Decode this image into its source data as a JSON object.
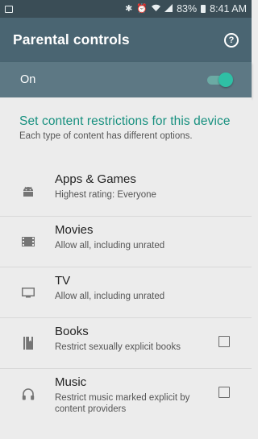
{
  "status_bar": {
    "time": "8:41 AM",
    "battery_percent": "83%",
    "icons": [
      "bluetooth-icon",
      "alarm-icon",
      "wifi-icon",
      "signal-icon",
      "battery-icon"
    ]
  },
  "app_bar": {
    "title": "Parental controls",
    "help_icon": "help-icon",
    "help_glyph": "?"
  },
  "master_switch": {
    "label": "On",
    "enabled": true
  },
  "section": {
    "title": "Set content restrictions for this device",
    "subtitle": "Each type of content has different options."
  },
  "content_types": [
    {
      "icon": "android-icon",
      "title": "Apps & Games",
      "subtitle": "Highest rating: Everyone"
    },
    {
      "icon": "film-icon",
      "title": "Movies",
      "subtitle": "Allow all, including unrated"
    },
    {
      "icon": "tv-icon",
      "title": "TV",
      "subtitle": "Allow all, including unrated"
    },
    {
      "icon": "book-icon",
      "title": "Books",
      "subtitle": "Restrict sexually explicit books",
      "checked": false
    },
    {
      "icon": "headphones-icon",
      "title": "Music",
      "subtitle": "Restrict music marked explicit by content providers",
      "checked": false
    }
  ],
  "colors": {
    "app_bar": "#4a6572",
    "switch_bar": "#5d7884",
    "accent": "#17907f",
    "toggle_thumb": "#2fbfa5"
  }
}
